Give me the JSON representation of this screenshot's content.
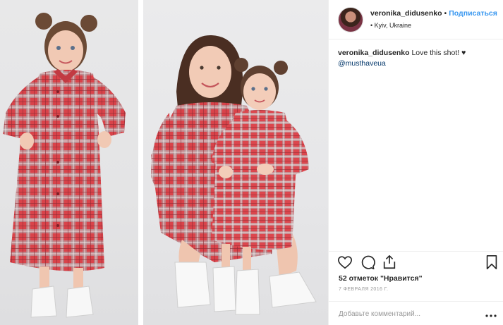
{
  "post": {
    "author": {
      "username": "veronika_didusenko",
      "separator": "•",
      "follow_label": "Подписаться",
      "location_prefix": "•",
      "location": "Kyiv, Ukraine"
    },
    "caption": {
      "username": "veronika_didusenko",
      "text": "Love this shot! ♥",
      "mention": "@musthaveua"
    },
    "likes_text": "52 отметок \"Нравится\"",
    "date_text": "7 ФЕВРАЛЯ 2016 Г.",
    "comment_placeholder": "Добавьте комментарий...",
    "icons": {
      "like": "heart-icon",
      "comment": "comment-icon",
      "share": "share-icon",
      "save": "bookmark-icon",
      "more": "more-options-icon"
    },
    "colors": {
      "follow": "#3897f0",
      "mention": "#003569",
      "muted": "#999999",
      "text": "#262626",
      "plaid_red": "#d9434a",
      "plaid_gray": "#a9a6a8"
    }
  }
}
